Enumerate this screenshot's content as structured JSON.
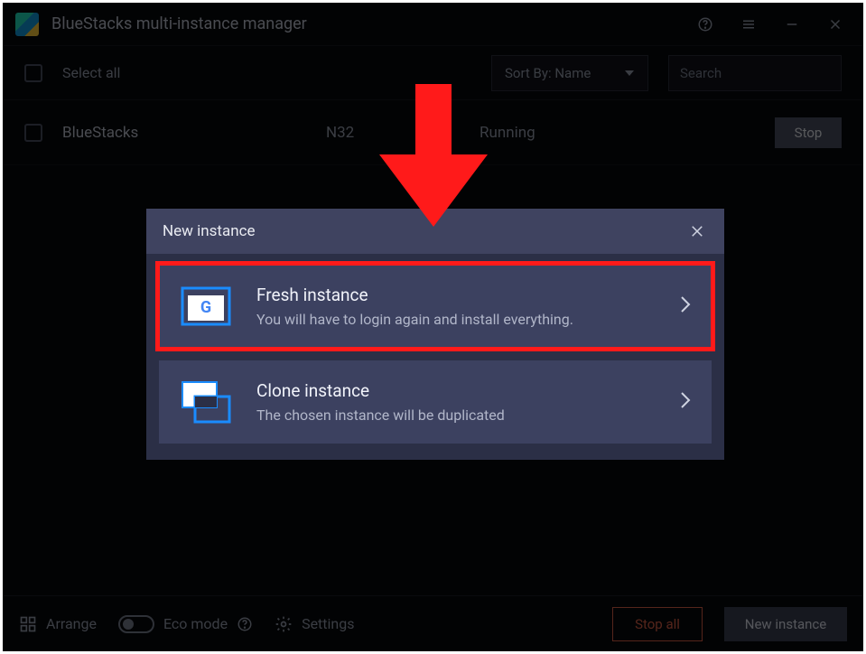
{
  "titlebar": {
    "title": "BlueStacks multi-instance manager"
  },
  "toolbar": {
    "select_all": "Select all",
    "sort_by_label": "Sort By: Name",
    "search_placeholder": "Search"
  },
  "instance": {
    "name": "BlueStacks",
    "arch": "N32",
    "status": "Running",
    "stop_label": "Stop"
  },
  "modal": {
    "title": "New instance",
    "options": [
      {
        "title": "Fresh instance",
        "desc": "You will have to login again and install everything."
      },
      {
        "title": "Clone instance",
        "desc": "The chosen instance will be duplicated"
      }
    ]
  },
  "footer": {
    "arrange": "Arrange",
    "eco": "Eco mode",
    "settings": "Settings",
    "stop_all": "Stop all",
    "new_instance": "New instance"
  }
}
